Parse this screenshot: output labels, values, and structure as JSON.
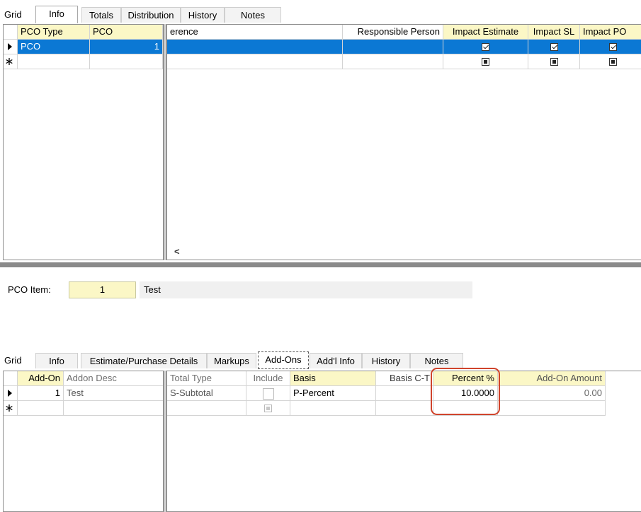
{
  "top_tabs": [
    "Grid",
    "Info",
    "Totals",
    "Distribution",
    "History",
    "Notes"
  ],
  "top_grid": {
    "left_headers": [
      "PCO Type",
      "PCO"
    ],
    "right_headers": [
      "erence",
      "Responsible Person",
      "Impact Estimate",
      "Impact SL",
      "Impact PO"
    ],
    "row": {
      "pco_type": "PCO",
      "pco": "1"
    }
  },
  "scroll_left_glyph": "<",
  "pco_item": {
    "label": "PCO Item:",
    "number": "1",
    "desc": "Test"
  },
  "bottom_tabs": [
    "Grid",
    "Info",
    "Estimate/Purchase Details",
    "Markups",
    "Add-Ons",
    "Add'l Info",
    "History",
    "Notes"
  ],
  "bottom_grid": {
    "left_headers": [
      "Add-On",
      "Addon Desc"
    ],
    "right_headers": [
      "Total Type",
      "Include",
      "Basis",
      "Basis C-T",
      "Percent %",
      "Add-On Amount"
    ],
    "row": {
      "addon": "1",
      "desc": "Test",
      "total_type": "S-Subtotal",
      "basis": "P-Percent",
      "percent": "10.0000",
      "amount": "0.00"
    }
  },
  "colors": {
    "header_yellow": "#fbf7c6",
    "selection_blue": "#0b78d4",
    "highlight_red": "#d0442c"
  }
}
